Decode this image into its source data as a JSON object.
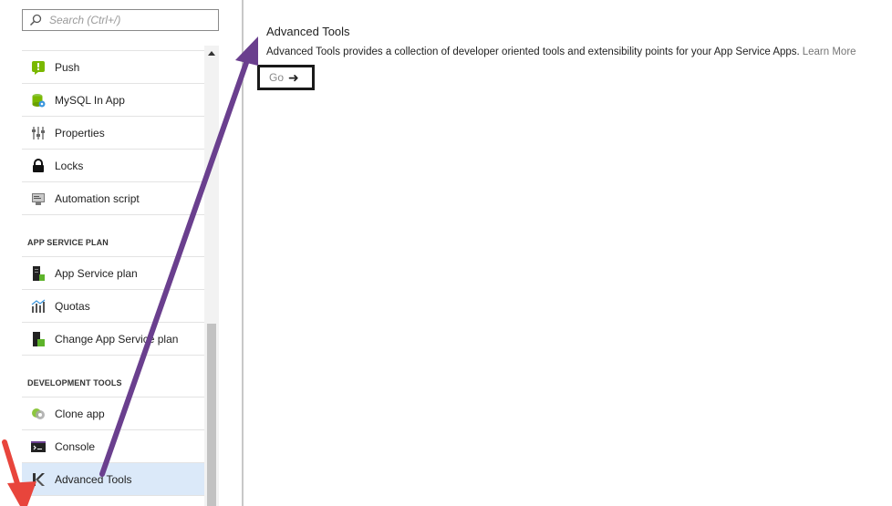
{
  "search": {
    "placeholder": "Search (Ctrl+/)"
  },
  "menu": {
    "top_items": [
      {
        "label": "Push",
        "icon": "push-icon"
      },
      {
        "label": "MySQL In App",
        "icon": "mysql-icon"
      },
      {
        "label": "Properties",
        "icon": "properties-icon"
      },
      {
        "label": "Locks",
        "icon": "lock-icon"
      },
      {
        "label": "Automation script",
        "icon": "automation-script-icon"
      }
    ],
    "app_service_plan_header": "APP SERVICE PLAN",
    "app_service_plan_items": [
      {
        "label": "App Service plan",
        "icon": "app-service-plan-icon"
      },
      {
        "label": "Quotas",
        "icon": "quotas-icon"
      },
      {
        "label": "Change App Service plan",
        "icon": "change-plan-icon"
      }
    ],
    "development_tools_header": "DEVELOPMENT TOOLS",
    "development_tools_items": [
      {
        "label": "Clone app",
        "icon": "clone-app-icon"
      },
      {
        "label": "Console",
        "icon": "console-icon"
      },
      {
        "label": "Advanced Tools",
        "icon": "advanced-tools-icon"
      }
    ]
  },
  "blade": {
    "title": "Advanced Tools",
    "description": "Advanced Tools provides a collection of developer oriented tools and extensibility points for your App Service Apps.",
    "learn_more": "Learn More",
    "go_label": "Go"
  },
  "colors": {
    "selected_bg": "#dbe9f9",
    "purple_arrow": "#6a3f8e",
    "red_arrow": "#e8453c",
    "push_green": "#7ab800",
    "plan_green": "#5db32a"
  }
}
